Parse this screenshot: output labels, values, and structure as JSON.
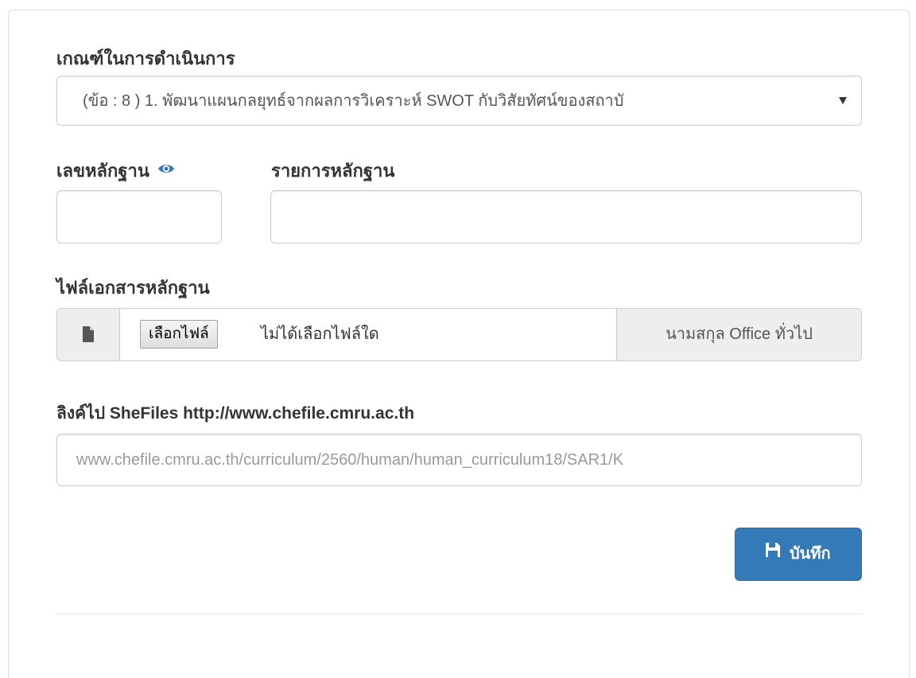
{
  "form": {
    "criteria_label": "เกณฑ์ในการดำเนินการ",
    "criteria_selected": "(ข้อ : 8 ) 1. พัฒนาแผนกลยุทธ์จากผลการวิเคราะห์ SWOT กับวิสัยทัศน์ของสถาบั",
    "evidence_no_label": "เลขหลักฐาน",
    "evidence_no_value": "",
    "evidence_list_label": "รายการหลักฐาน",
    "evidence_list_value": "",
    "file_label": "ไฟล์เอกสารหลักฐาน",
    "choose_file_button": "เลือกไฟล์",
    "no_file_text": "ไม่ได้เลือกไฟล์ใด",
    "file_owner": "นามสกุล Office ทั่วไป",
    "link_label": "ลิงค์ไป SheFiles http://www.chefile.cmru.ac.th",
    "link_value": "www.chefile.cmru.ac.th/curriculum/2560/human/human_curriculum18/SAR1/K",
    "save_button": "บันทึก"
  },
  "icons": {
    "eye": "eye-icon",
    "file": "file-icon",
    "save": "floppy-disk-icon"
  },
  "colors": {
    "primary": "#337ab7",
    "addon_bg": "#eeeeee",
    "border": "#cccccc"
  }
}
